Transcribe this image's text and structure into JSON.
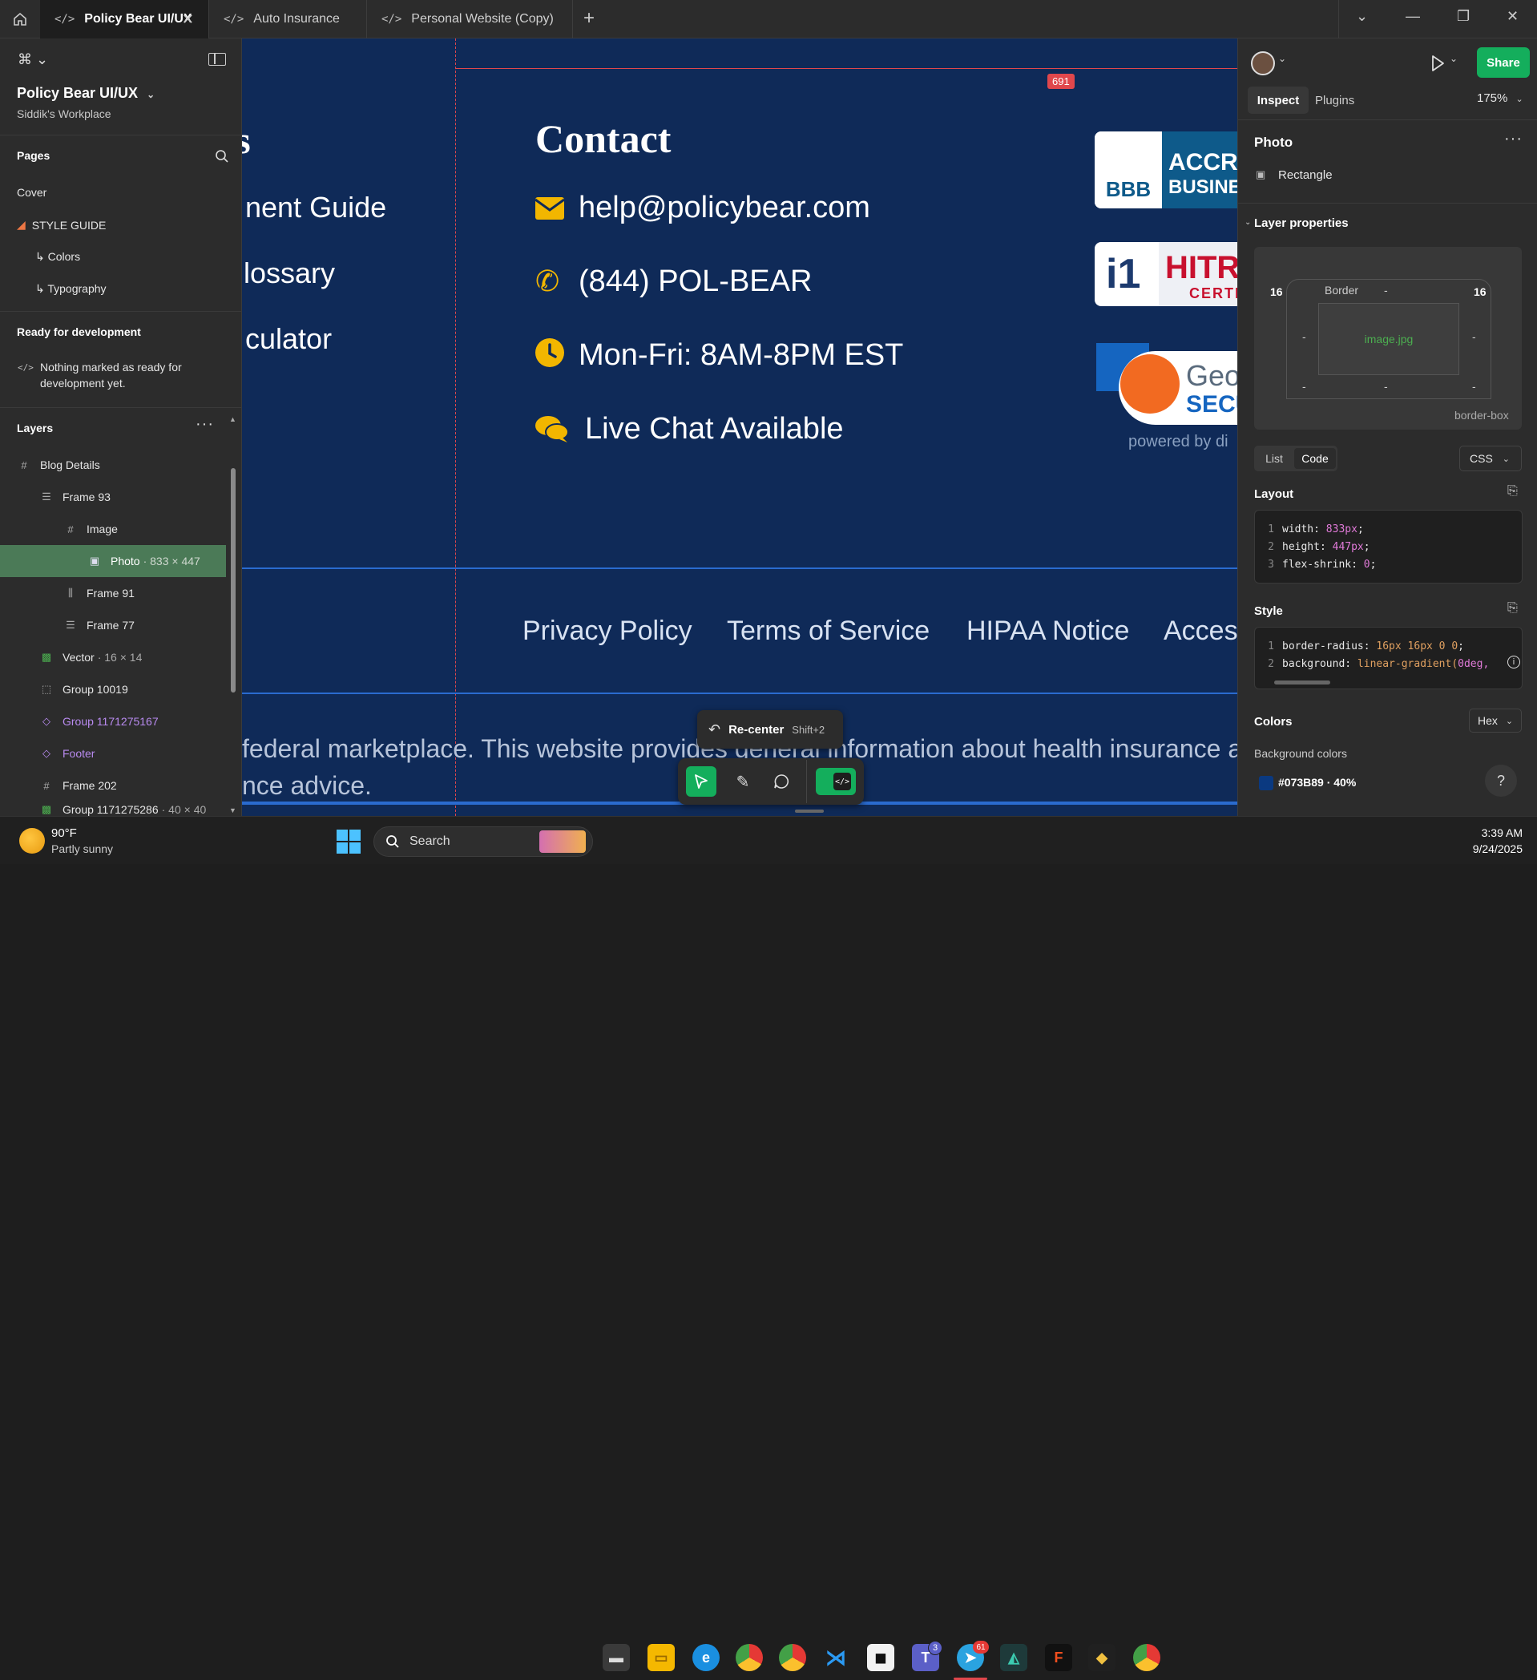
{
  "tabs": [
    {
      "label": "Policy Bear UI/UX",
      "active": true
    },
    {
      "label": "Auto Insurance"
    },
    {
      "label": "Personal Website (Copy)"
    }
  ],
  "left": {
    "project": "Policy Bear UI/UX",
    "workspace": "Siddik's Workplace",
    "pages_label": "Pages",
    "pages": [
      "Cover",
      "STYLE GUIDE",
      "↳ Colors",
      "↳ Typography"
    ],
    "ready_label": "Ready for development",
    "ready_text": "Nothing marked as ready for development yet.",
    "layers_label": "Layers",
    "layers": [
      {
        "name": "Blog Details",
        "meta": ""
      },
      {
        "name": "Frame 93",
        "meta": ""
      },
      {
        "name": "Image",
        "meta": ""
      },
      {
        "name": "Photo",
        "meta": "· 833 × 447"
      },
      {
        "name": "Frame 91",
        "meta": ""
      },
      {
        "name": "Frame 77",
        "meta": ""
      },
      {
        "name": "Vector",
        "meta": "· 16 × 14"
      },
      {
        "name": "Group 10019",
        "meta": ""
      },
      {
        "name": "Group 1171275167",
        "meta": ""
      },
      {
        "name": "Footer",
        "meta": ""
      },
      {
        "name": "Frame 202",
        "meta": ""
      },
      {
        "name": "Group 1171275286",
        "meta": "· 40 × 40"
      }
    ]
  },
  "canvas": {
    "left_links": [
      "s",
      "nent Guide",
      "lossary",
      "culator"
    ],
    "contact_title": "Contact",
    "email": "help@policybear.com",
    "phone": "(844) POL-BEAR",
    "hours": "Mon-Fri: 8AM-8PM EST",
    "chat": "Live Chat Available",
    "badge_number": "691",
    "bbb_line1": "ACCRE",
    "bbb_line2": "BUSINE",
    "bbb_logo": "BBB",
    "hitrust_logo": "i1",
    "hitrust_line1": "HITR",
    "hitrust_line2": "CERTI",
    "geotrust_line1": "GeoT",
    "geotrust_line2": "SECU",
    "geotrust_powered": "powered by di",
    "footer_links": [
      "Privacy Policy",
      "Terms of Service",
      "HIPAA Notice",
      "Acces"
    ],
    "disclaimer_line1": "federal marketplace. This website provides general information about health insurance and is",
    "disclaimer_line2": "nce advice.",
    "recenter_label": "Re-center",
    "recenter_shortcut": "Shift+2"
  },
  "right": {
    "share_label": "Share",
    "tab_inspect": "Inspect",
    "tab_plugins": "Plugins",
    "zoom": "175%",
    "selection_title": "Photo",
    "selection_type": "Rectangle",
    "layer_props_label": "Layer properties",
    "box": {
      "radius_left": "16",
      "radius_right": "16",
      "border_label": "Border",
      "dash": "-",
      "content": "image.jpg",
      "sizing": "border-box"
    },
    "view_list": "List",
    "view_code": "Code",
    "lang": "CSS",
    "layout_label": "Layout",
    "layout_code": [
      {
        "n": "1",
        "k": "width:",
        "v": "833px",
        "end": ";"
      },
      {
        "n": "2",
        "k": "height:",
        "v": "447px",
        "end": ";"
      },
      {
        "n": "3",
        "k": "flex-shrink:",
        "v": "0",
        "end": ";"
      }
    ],
    "style_label": "Style",
    "style_code": [
      {
        "n": "1",
        "k": "border-radius:",
        "v": "16px 16px 0 0",
        "end": ";"
      },
      {
        "n": "2",
        "k": "background:",
        "v": "linear-gradient(",
        "v2": "0deg,",
        "end": ""
      }
    ],
    "colors_label": "Colors",
    "color_format": "Hex",
    "bg_colors_label": "Background colors",
    "swatch_text": "#073B89 · 40%",
    "swatch_color": "#073B89",
    "help": "?"
  },
  "taskbar": {
    "temp": "90°F",
    "weather": "Partly sunny",
    "search": "Search",
    "time": "3:39 AM",
    "date": "9/24/2025",
    "teams_badge": "3",
    "telegram_badge": "61"
  }
}
